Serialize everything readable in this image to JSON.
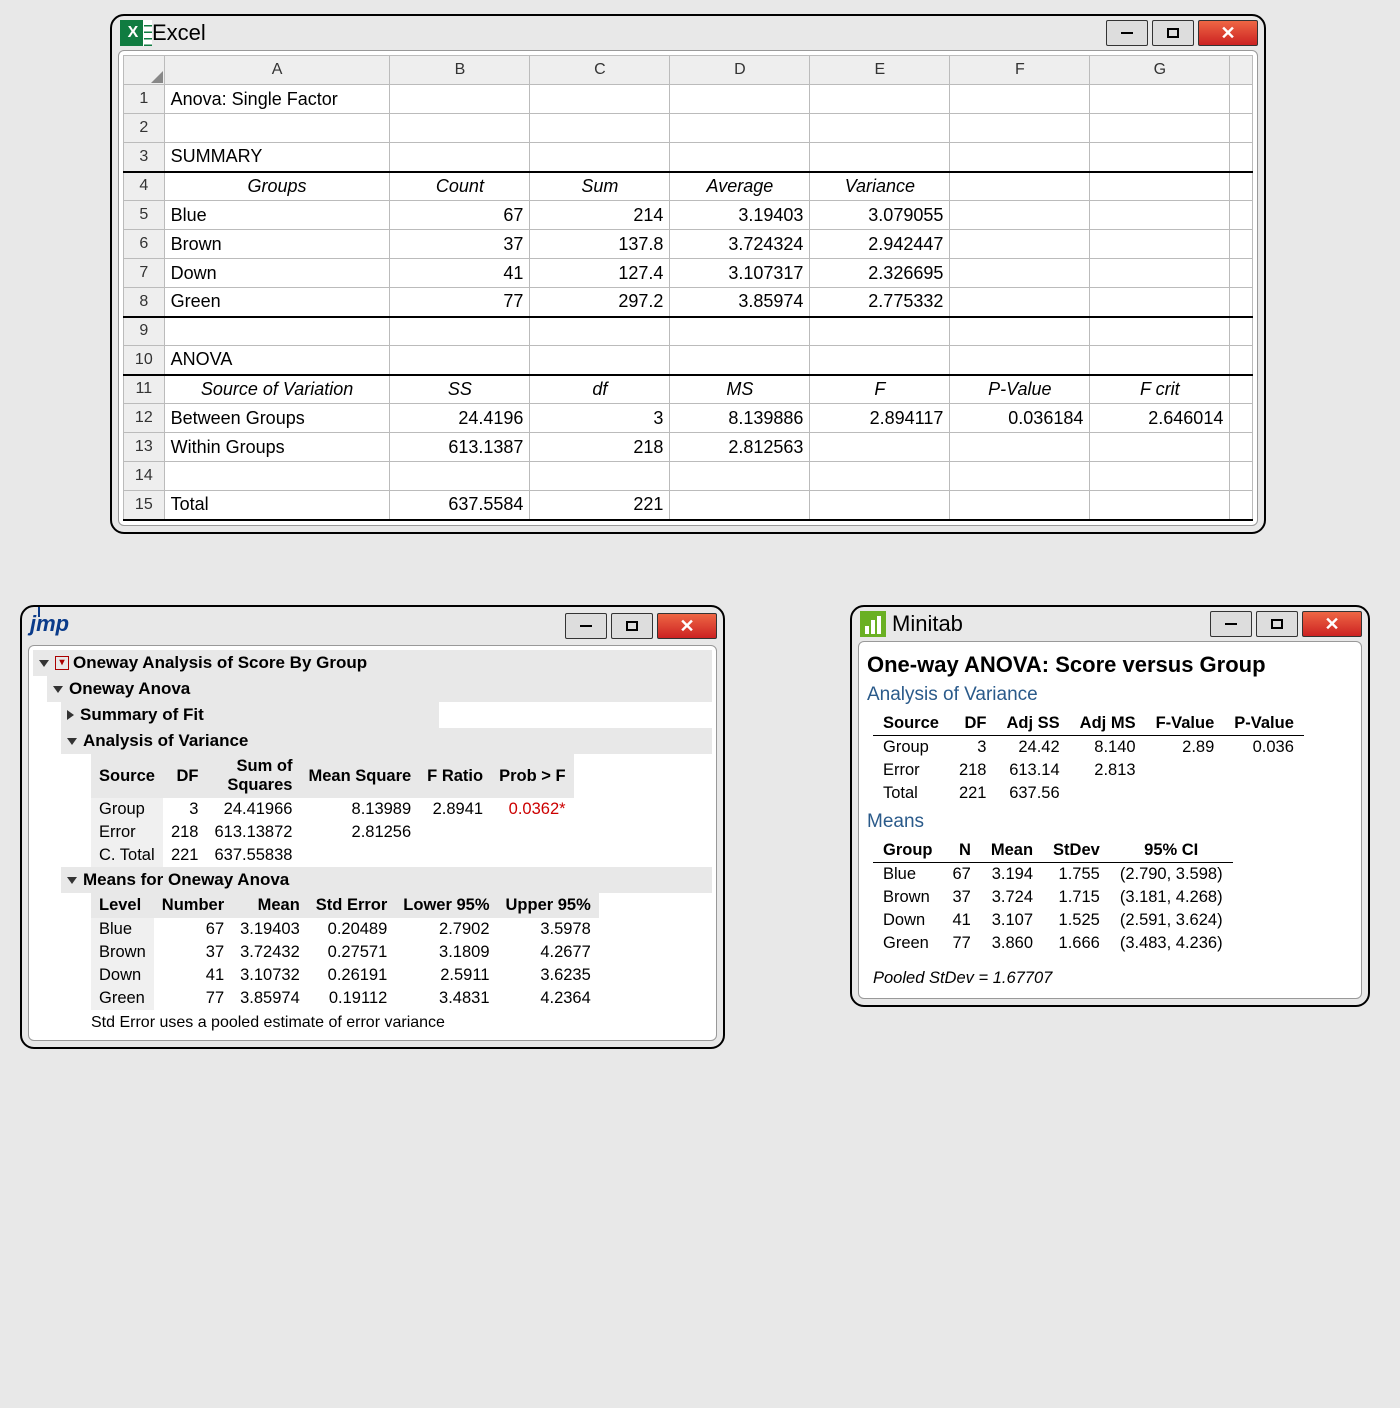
{
  "excel": {
    "title": "Excel",
    "cols": [
      "A",
      "B",
      "C",
      "D",
      "E",
      "F",
      "G"
    ],
    "rows": [
      [
        "Anova: Single Factor",
        "",
        "",
        "",
        "",
        "",
        ""
      ],
      [
        "",
        "",
        "",
        "",
        "",
        "",
        ""
      ],
      [
        "SUMMARY",
        "",
        "",
        "",
        "",
        "",
        ""
      ],
      [
        "Groups",
        "Count",
        "Sum",
        "Average",
        "Variance",
        "",
        ""
      ],
      [
        "Blue",
        "67",
        "214",
        "3.19403",
        "3.079055",
        "",
        ""
      ],
      [
        "Brown",
        "37",
        "137.8",
        "3.724324",
        "2.942447",
        "",
        ""
      ],
      [
        "Down",
        "41",
        "127.4",
        "3.107317",
        "2.326695",
        "",
        ""
      ],
      [
        "Green",
        "77",
        "297.2",
        "3.85974",
        "2.775332",
        "",
        ""
      ],
      [
        "",
        "",
        "",
        "",
        "",
        "",
        ""
      ],
      [
        "ANOVA",
        "",
        "",
        "",
        "",
        "",
        ""
      ],
      [
        "Source of Variation",
        "SS",
        "df",
        "MS",
        "F",
        "P-Value",
        "F crit"
      ],
      [
        "Between Groups",
        "24.4196",
        "3",
        "8.139886",
        "2.894117",
        "0.036184",
        "2.646014"
      ],
      [
        "Within Groups",
        "613.1387",
        "218",
        "2.812563",
        "",
        "",
        ""
      ],
      [
        "",
        "",
        "",
        "",
        "",
        "",
        ""
      ],
      [
        "Total",
        "637.5584",
        "221",
        "",
        "",
        "",
        ""
      ]
    ]
  },
  "jmp": {
    "title": "Oneway Analysis of Score By Group",
    "sec1": "Oneway Anova",
    "sec2": "Summary of Fit",
    "sec3": "Analysis of Variance",
    "sec4": "Means for Oneway Anova",
    "anova_head": [
      "Source",
      "DF",
      "Sum of\nSquares",
      "Mean Square",
      "F Ratio",
      "Prob > F"
    ],
    "anova": [
      [
        "Group",
        "3",
        "24.41966",
        "8.13989",
        "2.8941",
        "0.0362*"
      ],
      [
        "Error",
        "218",
        "613.13872",
        "2.81256",
        "",
        ""
      ],
      [
        "C. Total",
        "221",
        "637.55838",
        "",
        "",
        ""
      ]
    ],
    "means_head": [
      "Level",
      "Number",
      "Mean",
      "Std Error",
      "Lower 95%",
      "Upper 95%"
    ],
    "means": [
      [
        "Blue",
        "67",
        "3.19403",
        "0.20489",
        "2.7902",
        "3.5978"
      ],
      [
        "Brown",
        "37",
        "3.72432",
        "0.27571",
        "3.1809",
        "4.2677"
      ],
      [
        "Down",
        "41",
        "3.10732",
        "0.26191",
        "2.5911",
        "3.6235"
      ],
      [
        "Green",
        "77",
        "3.85974",
        "0.19112",
        "3.4831",
        "4.2364"
      ]
    ],
    "note": "Std Error uses a pooled estimate of error variance"
  },
  "minitab": {
    "app": "Minitab",
    "h1": "One-way ANOVA: Score versus Group",
    "h2a": "Analysis of Variance",
    "anova_head": [
      "Source",
      "DF",
      "Adj SS",
      "Adj MS",
      "F-Value",
      "P-Value"
    ],
    "anova": [
      [
        "Group",
        "3",
        "24.42",
        "8.140",
        "2.89",
        "0.036"
      ],
      [
        "Error",
        "218",
        "613.14",
        "2.813",
        "",
        ""
      ],
      [
        "Total",
        "221",
        "637.56",
        "",
        "",
        ""
      ]
    ],
    "h2b": "Means",
    "means_head": [
      "Group",
      "N",
      "Mean",
      "StDev",
      "95% CI"
    ],
    "means": [
      [
        "Blue",
        "67",
        "3.194",
        "1.755",
        "(2.790, 3.598)"
      ],
      [
        "Brown",
        "37",
        "3.724",
        "1.715",
        "(3.181, 4.268)"
      ],
      [
        "Down",
        "41",
        "3.107",
        "1.525",
        "(2.591, 3.624)"
      ],
      [
        "Green",
        "77",
        "3.860",
        "1.666",
        "(3.483, 4.236)"
      ]
    ],
    "note": "Pooled StDev = 1.67707"
  }
}
